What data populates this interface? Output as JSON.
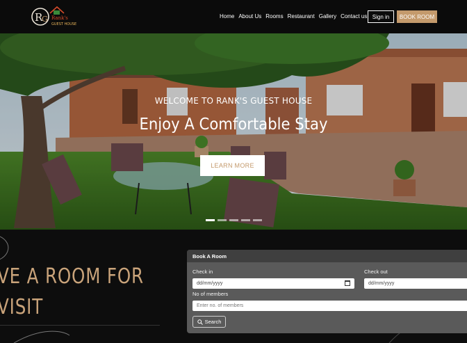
{
  "brand": {
    "logo_letters": "RG",
    "logo_name": "Rank's",
    "logo_sub": "GUEST HOUSE"
  },
  "nav": {
    "items": [
      "Home",
      "About Us",
      "Rooms",
      "Restaurant",
      "Gallery",
      "Contact us"
    ],
    "signin": "Sign in",
    "book_room": "BOOK ROOM"
  },
  "hero": {
    "welcome": "WELCOME TO RANK'S GUEST HOUSE",
    "tagline": "Enjoy A Comfortable Stay",
    "cta": "LEARN MORE",
    "slides": 5,
    "active_slide": 1
  },
  "promo": {
    "line1": "VE A ROOM FOR",
    "line2": "VISIT"
  },
  "booking": {
    "title": "Book A Room",
    "checkin_label": "Check in",
    "checkin_value": "dd/mm/yyyy",
    "checkout_label": "Check out",
    "checkout_value": "dd/mm/yyyy",
    "members_label": "No of members",
    "members_placeholder": "Enter no. of members",
    "search_label": "Search"
  },
  "colors": {
    "accent": "#c49a6c",
    "header_bg": "#0b0b0b",
    "panel_bg": "#5a5a5a"
  }
}
